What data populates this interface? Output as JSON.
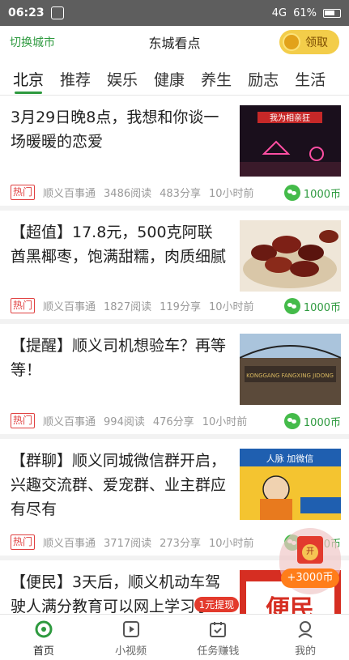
{
  "status_bar": {
    "time": "06:23",
    "network": "4G",
    "battery": "61%"
  },
  "header": {
    "switch_city": "切换城市",
    "title": "东城看点",
    "claim_label": "领取"
  },
  "tabs": [
    {
      "label": "北京"
    },
    {
      "label": "推荐"
    },
    {
      "label": "娱乐"
    },
    {
      "label": "健康"
    },
    {
      "label": "养生"
    },
    {
      "label": "励志"
    },
    {
      "label": "生活"
    }
  ],
  "articles": [
    {
      "title": "3月29日晚8点，我想和你谈一场暖暖的恋爱",
      "tag": "热门",
      "source": "顺义百事通",
      "reads": "3486阅读",
      "shares": "483分享",
      "time": "10小时前",
      "reward": "1000币",
      "thumb_text": "我为相亲狂"
    },
    {
      "title": "【超值】17.8元，500克阿联酋黑椰枣，饱满甜糯，肉质细腻",
      "tag": "热门",
      "source": "顺义百事通",
      "reads": "1827阅读",
      "shares": "119分享",
      "time": "10小时前",
      "reward": "1000币",
      "thumb_text": ""
    },
    {
      "title": "【提醒】顺义司机想验车？再等等！",
      "tag": "热门",
      "source": "顺义百事通",
      "reads": "994阅读",
      "shares": "476分享",
      "time": "10小时前",
      "reward": "1000币",
      "thumb_text": "KONGGANG FANGXING JIDONG"
    },
    {
      "title": "【群聊】顺义同城微信群开启，兴趣交流群、爱宠群、业主群应有尽有",
      "tag": "热门",
      "source": "顺义百事通",
      "reads": "3717阅读",
      "shares": "273分享",
      "time": "10小时前",
      "reward": "1000币",
      "thumb_text": "人脉 加微信"
    },
    {
      "title": "【便民】3天后，顺义机动车驾驶人满分教育可以网上学习了",
      "tag": "",
      "source": "",
      "reads": "",
      "shares": "",
      "time": "",
      "reward": "",
      "thumb_text": "便民"
    }
  ],
  "red_packet": {
    "open_label": "开",
    "amount": "+3000币"
  },
  "bottom_nav": [
    {
      "label": "首页"
    },
    {
      "label": "小视频"
    },
    {
      "label": "任务赚钱",
      "badge": "1元提现"
    },
    {
      "label": "我的"
    }
  ],
  "colors": {
    "accent": "#2e9a3f",
    "hot": "#e04040",
    "claim_bg": "#f3cd4a"
  }
}
